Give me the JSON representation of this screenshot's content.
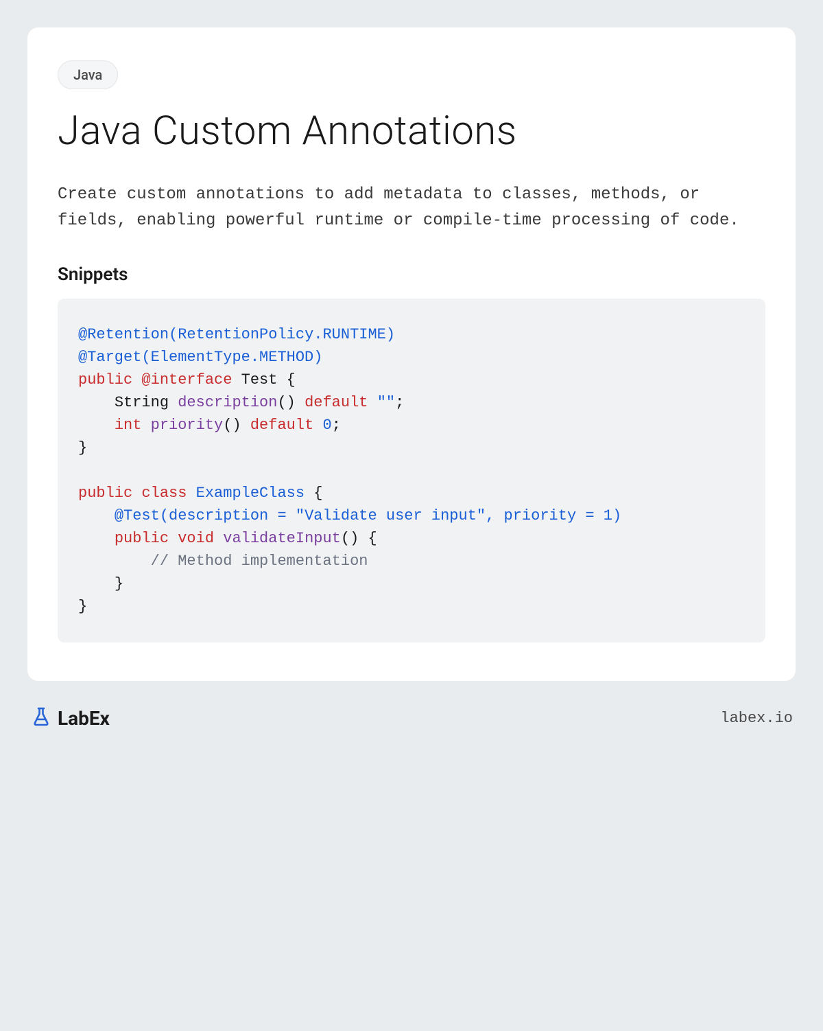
{
  "tag": "Java",
  "title": "Java Custom Annotations",
  "description": "Create custom annotations to add metadata to classes, methods, or fields, enabling powerful runtime or compile-time processing of code.",
  "section_heading": "Snippets",
  "code": {
    "line1_ann1": "@Retention",
    "line1_arg": "(RetentionPolicy.RUNTIME)",
    "line2_ann2": "@Target",
    "line2_arg": "(ElementType.METHOD)",
    "kw_public": "public",
    "kw_interface": "@interface",
    "interface_name": " Test {",
    "type_string": "String",
    "id_description": "description",
    "call_paren": "()",
    "kw_default": "default",
    "val_empty": "\"\"",
    "semi": ";",
    "type_int": "int",
    "id_priority": "priority",
    "val_zero": "0",
    "brace_close": "}",
    "kw_class": "class",
    "class_name": "ExampleClass",
    "brace_open": " {",
    "ann_test": "@Test",
    "test_args_open": "(description = ",
    "test_str": "\"Validate user input\"",
    "test_args_mid": ", priority = ",
    "test_val1": "1",
    "test_args_close": ")",
    "kw_void": "void",
    "method_name": "validateInput",
    "method_sig": "() {",
    "comment": "// Method implementation"
  },
  "footer": {
    "brand": "LabEx",
    "site": "labex.io"
  }
}
